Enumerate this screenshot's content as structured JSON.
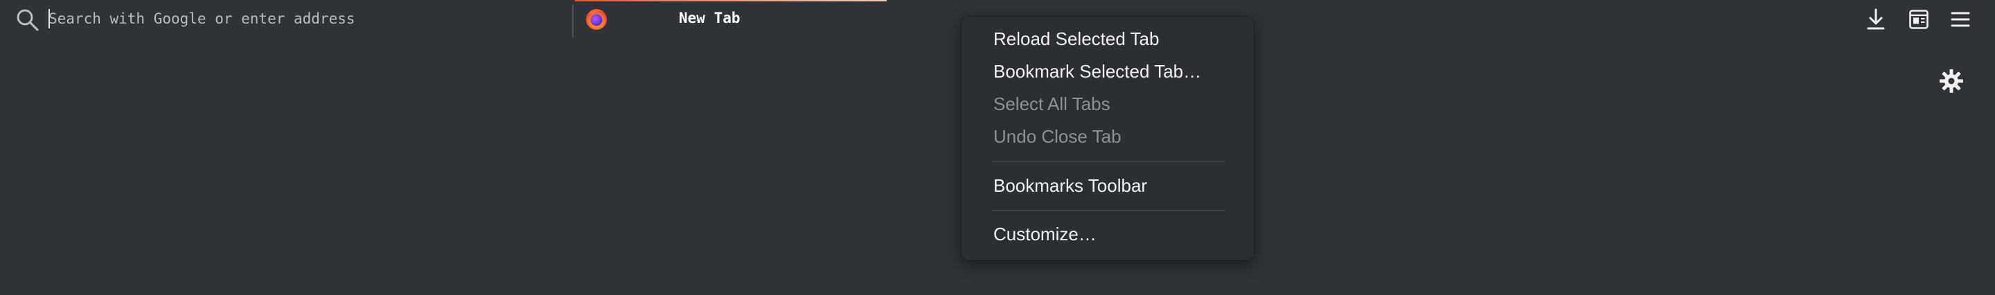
{
  "urlbar": {
    "placeholder": "Search with Google or enter address",
    "value": ""
  },
  "tab": {
    "label": "New Tab",
    "favicon": "firefox-logo"
  },
  "toolbar": {
    "buttons": [
      {
        "name": "downloads",
        "icon": "download-arrow-icon"
      },
      {
        "name": "reader-sidebar",
        "icon": "reader-view-icon"
      },
      {
        "name": "app-menu",
        "icon": "hamburger-menu-icon"
      }
    ]
  },
  "page": {
    "settings_icon": "gear-icon"
  },
  "context_menu": {
    "items": [
      {
        "label": "Reload Selected Tab",
        "enabled": true
      },
      {
        "label": "Bookmark Selected Tab…",
        "enabled": true
      },
      {
        "label": "Select All Tabs",
        "enabled": false
      },
      {
        "label": "Undo Close Tab",
        "enabled": false
      },
      {
        "label": "Bookmarks Toolbar",
        "enabled": true
      },
      {
        "label": "Customize…",
        "enabled": true
      }
    ]
  },
  "colors": {
    "background": "#2f3337",
    "menu_background": "#2b2e32",
    "text": "#f2f2f2",
    "disabled_text": "#8e9194",
    "tab_accent": "#e05a2b"
  }
}
